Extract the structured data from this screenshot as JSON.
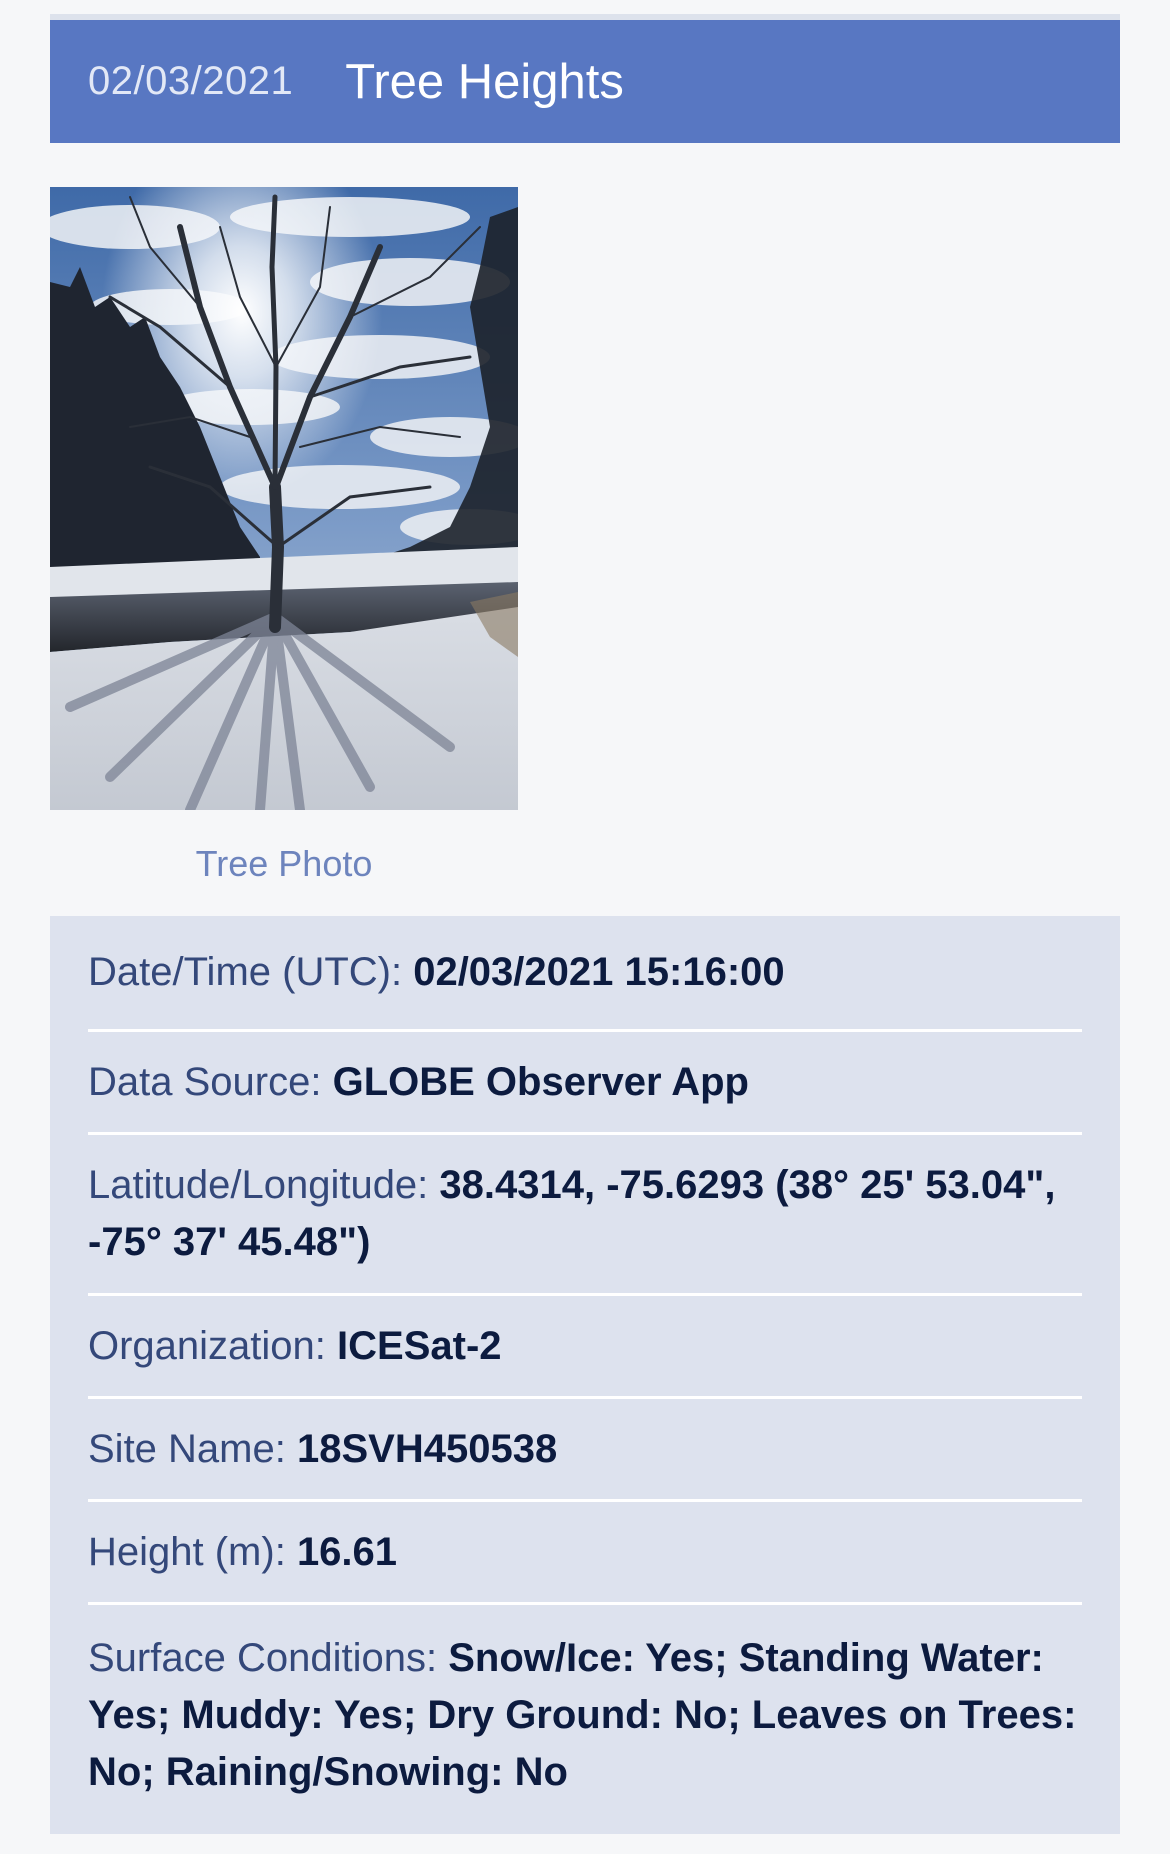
{
  "header": {
    "date": "02/03/2021",
    "title": "Tree Heights"
  },
  "photo": {
    "caption": "Tree Photo",
    "alt": "Tree Photo"
  },
  "details": [
    {
      "label": "Date/Time (UTC): ",
      "value": "02/03/2021 15:16:00"
    },
    {
      "label": "Data Source: ",
      "value": "GLOBE Observer App"
    },
    {
      "label": "Latitude/Longitude: ",
      "value": "38.4314, -75.6293 (38° 25' 53.04\", -75° 37' 45.48\")"
    },
    {
      "label": "Organization: ",
      "value": "ICESat-2"
    },
    {
      "label": "Site Name: ",
      "value": "18SVH450538"
    },
    {
      "label": "Height (m): ",
      "value": "16.61"
    },
    {
      "label": "Surface Conditions: ",
      "value": "Snow/Ice: Yes; Standing Water: Yes; Muddy: Yes; Dry Ground: No; Leaves on Trees: No; Raining/Snowing: No"
    }
  ],
  "colors": {
    "header_bg": "#5877c2",
    "details_bg": "#dde2ee",
    "label_text": "#34487a",
    "value_text": "#0c1b3f",
    "caption_text": "#6d84bd"
  }
}
